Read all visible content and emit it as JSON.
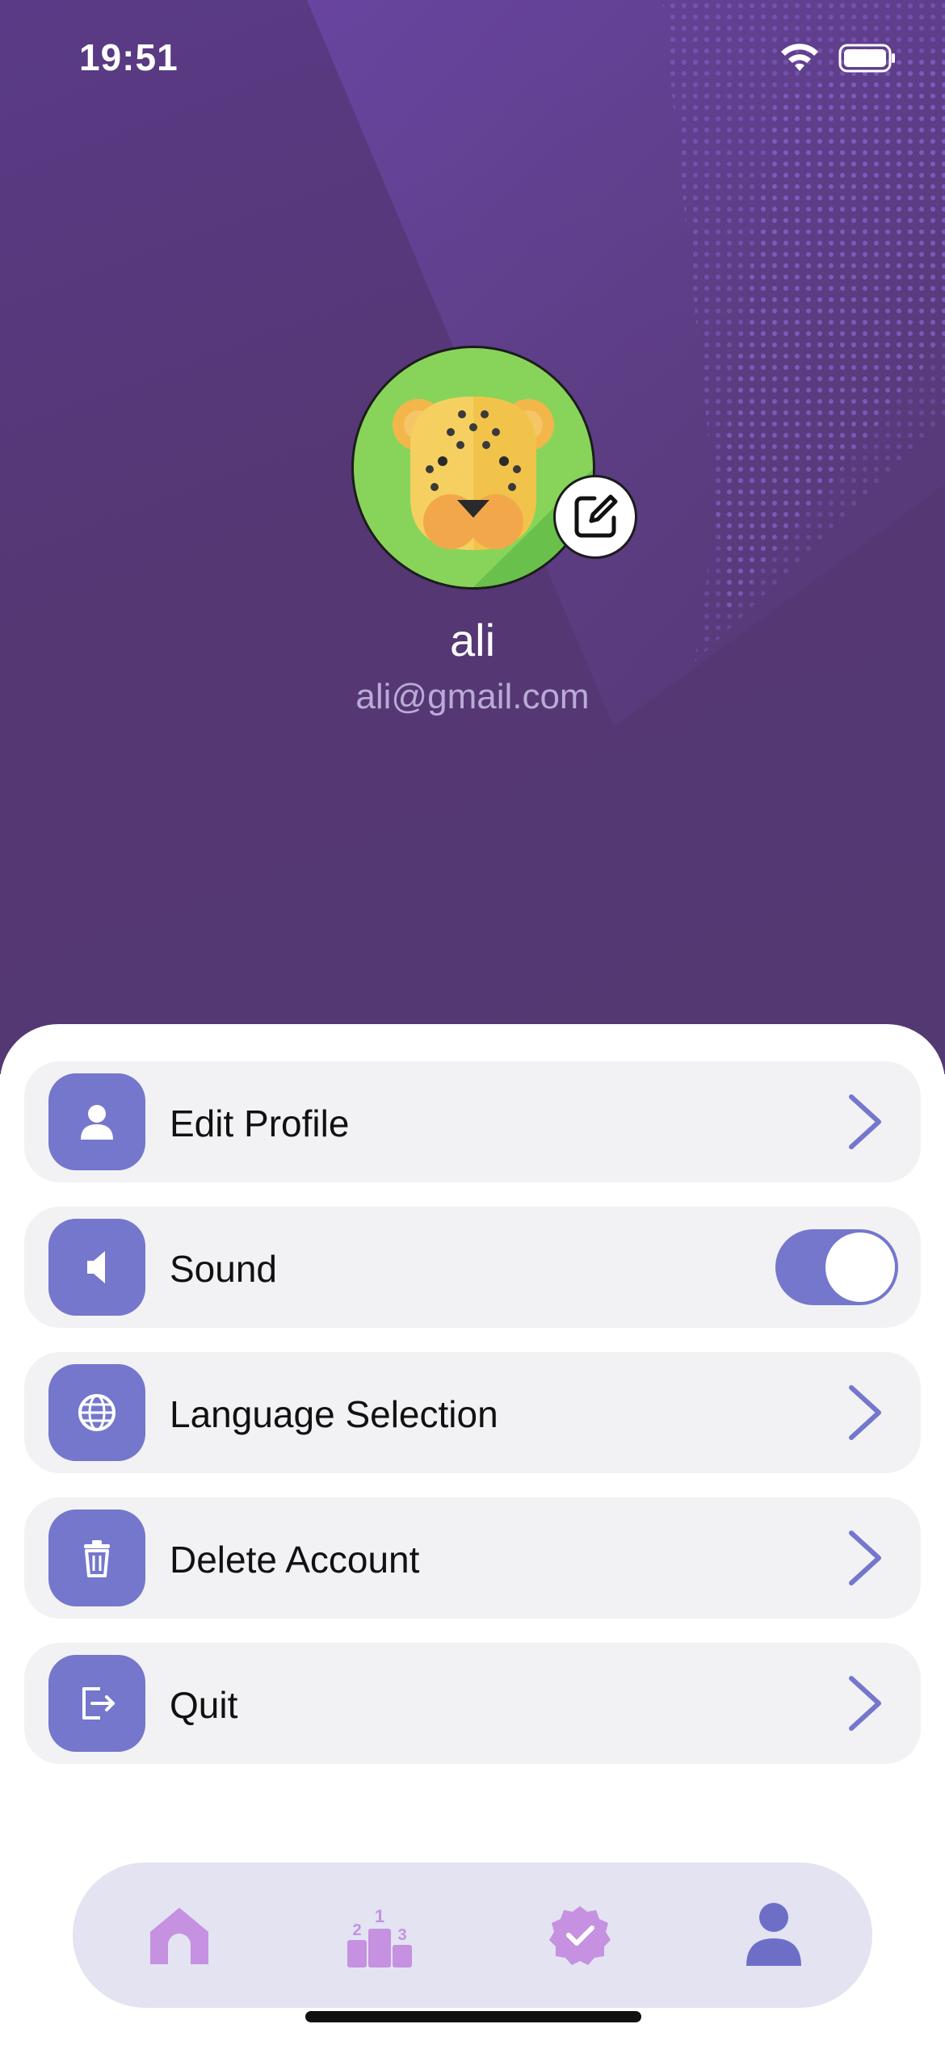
{
  "status_bar": {
    "time": "19:51",
    "wifi_icon": "wifi-icon",
    "battery_icon": "battery-icon"
  },
  "profile": {
    "name": "ali",
    "email": "ali@gmail.com",
    "avatar_icon": "leopard-avatar",
    "edit_icon": "edit-square-icon"
  },
  "menu": {
    "items": [
      {
        "label": "Edit Profile",
        "icon": "person-icon",
        "control": "chevron"
      },
      {
        "label": "Sound",
        "icon": "speaker-icon",
        "control": "toggle",
        "toggle_on": true
      },
      {
        "label": "Language Selection",
        "icon": "globe-icon",
        "control": "chevron"
      },
      {
        "label": "Delete Account",
        "icon": "trash-icon",
        "control": "chevron"
      },
      {
        "label": "Quit",
        "icon": "logout-icon",
        "control": "chevron"
      }
    ]
  },
  "tabbar": {
    "tabs": [
      {
        "name": "home",
        "icon": "home-icon",
        "active": false
      },
      {
        "name": "leaderboard",
        "icon": "podium-icon",
        "active": false
      },
      {
        "name": "achievements",
        "icon": "badge-check-icon",
        "active": false
      },
      {
        "name": "profile",
        "icon": "person-icon",
        "active": true
      }
    ]
  },
  "colors": {
    "hero_background": "#553774",
    "accent": "#7477cc",
    "tab_inactive": "#c591e0",
    "row_background": "#f2f2f5",
    "tabbar_background": "#e3e3f1"
  }
}
